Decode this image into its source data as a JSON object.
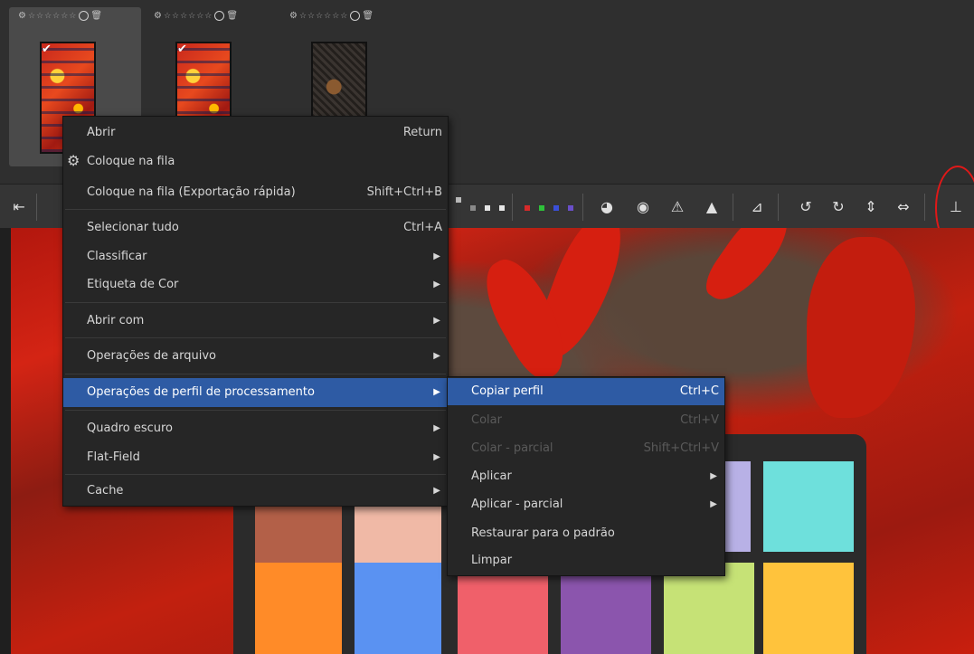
{
  "filmstrip": {
    "thumbnails": [
      {
        "stars": "☆☆☆☆☆☆",
        "selected": true,
        "checked": true
      },
      {
        "stars": "☆☆☆☆☆☆",
        "selected": false,
        "checked": true
      },
      {
        "stars": "☆☆☆☆☆☆",
        "selected": false,
        "checked": false
      }
    ]
  },
  "context_menu": {
    "items": [
      {
        "label": "Abrir",
        "shortcut": "Return"
      },
      {
        "label": "Coloque na fila",
        "icon": "gears-icon"
      },
      {
        "label": "Coloque na fila (Exportação rápida)",
        "shortcut": "Shift+Ctrl+B"
      },
      {
        "label": "Selecionar tudo",
        "shortcut": "Ctrl+A"
      },
      {
        "label": "Classificar",
        "submenu": true
      },
      {
        "label": "Etiqueta de Cor",
        "submenu": true
      },
      {
        "label": "Abrir com",
        "submenu": true
      },
      {
        "label": "Operações de arquivo",
        "submenu": true
      },
      {
        "label": "Operações de perfil de processamento",
        "submenu": true,
        "highlighted": true
      },
      {
        "label": "Quadro escuro",
        "submenu": true
      },
      {
        "label": "Flat-Field",
        "submenu": true
      },
      {
        "label": "Cache",
        "submenu": true
      }
    ]
  },
  "submenu": {
    "items": [
      {
        "label": "Copiar perfil",
        "shortcut": "Ctrl+C",
        "highlighted": true
      },
      {
        "label": "Colar",
        "shortcut": "Ctrl+V",
        "disabled": true
      },
      {
        "label": "Colar - parcial",
        "shortcut": "Shift+Ctrl+V",
        "disabled": true
      },
      {
        "label": "Aplicar",
        "submenu": true
      },
      {
        "label": "Aplicar - parcial",
        "submenu": true
      },
      {
        "label": "Restaurar para o padrão"
      },
      {
        "label": "Limpar"
      }
    ]
  },
  "toolbar": {
    "icons": [
      "collapse-left-icon",
      "color-label-none",
      "color-label-grey",
      "color-label-white",
      "color-label-red",
      "color-label-green",
      "color-label-blue",
      "color-label-purple",
      "clipped-shadows-icon",
      "clipped-highlights-icon",
      "warning-icon",
      "warning-filled-icon",
      "flip-icon",
      "rotate-left-icon",
      "rotate-right-icon",
      "flip-vertical-icon",
      "flip-horizontal-icon",
      "sidecar-icon"
    ],
    "colors": {
      "red": "#d62a2a",
      "green": "#2ec13a",
      "blue": "#3a4fd8",
      "purple": "#6a4fc9",
      "grey": "#8a8a8a",
      "white": "#e6e6e6",
      "annotation": "#e01818"
    }
  },
  "menu_colors": {
    "highlight": "#2e5ba4",
    "background": "#262626",
    "disabled": "#5a5a5a"
  }
}
